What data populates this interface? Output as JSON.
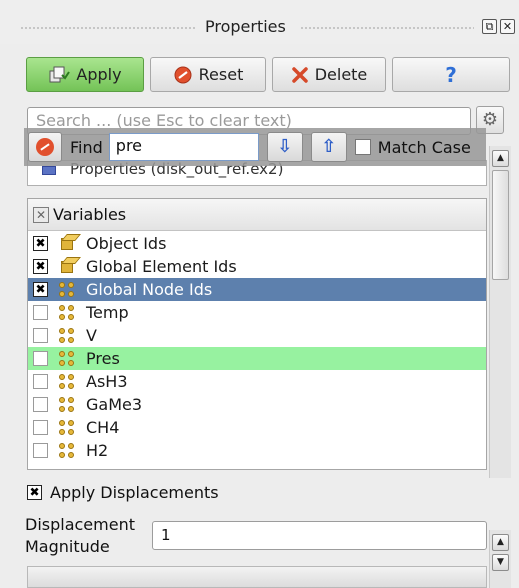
{
  "window": {
    "title": "Properties",
    "float_glyph": "⧉",
    "close_glyph": "✕"
  },
  "toolbar": {
    "apply_label": "Apply",
    "reset_label": "Reset",
    "delete_label": "Delete",
    "help_glyph": "?"
  },
  "search": {
    "placeholder": "Search ... (use Esc to clear text)"
  },
  "find": {
    "label": "Find",
    "value": "pre",
    "down_glyph": "⇩",
    "up_glyph": "⇧",
    "match_case_label": "Match Case",
    "match_case_checked": false
  },
  "pipeline": {
    "item_label": "Properties (disk_out_ref.ex2)"
  },
  "variables": {
    "header_label": "Variables",
    "header_check": "✕",
    "items": [
      {
        "name": "Object Ids",
        "checked": true,
        "icon": "cell-data-icon"
      },
      {
        "name": "Global Element Ids",
        "checked": true,
        "icon": "cell-data-icon"
      },
      {
        "name": "Global Node Ids",
        "checked": true,
        "icon": "point-data-icon"
      },
      {
        "name": "Temp",
        "checked": false,
        "icon": "point-data-icon"
      },
      {
        "name": "V",
        "checked": false,
        "icon": "point-data-icon"
      },
      {
        "name": "Pres",
        "checked": false,
        "icon": "point-data-icon"
      },
      {
        "name": "AsH3",
        "checked": false,
        "icon": "point-data-icon"
      },
      {
        "name": "GaMe3",
        "checked": false,
        "icon": "point-data-icon"
      },
      {
        "name": "CH4",
        "checked": false,
        "icon": "point-data-icon"
      },
      {
        "name": "H2",
        "checked": false,
        "icon": "point-data-icon"
      }
    ]
  },
  "displacements": {
    "apply_label": "Apply Displacements",
    "apply_checked": true,
    "magnitude_label_line1": "Displacement",
    "magnitude_label_line2": "Magnitude",
    "magnitude_value": "1"
  },
  "colors": {
    "apply_green": "#74c357",
    "selection_blue": "#5d80ad",
    "match_green": "#97f2a0"
  }
}
